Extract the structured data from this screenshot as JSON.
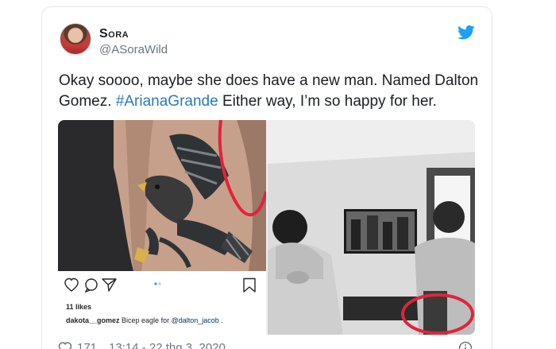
{
  "author": {
    "name": "Sora",
    "handle": "@ASoraWild"
  },
  "tweet": {
    "text_before": "Okay soooo, maybe she does have a new man. Named Dalton Gomez. ",
    "hashtag": "#ArianaGrande",
    "text_after": " Either way, I’m so happy for her."
  },
  "instagram": {
    "likes": "11 likes",
    "caption_user": "dakota__gomez",
    "caption_text": " Bicep eagle for ",
    "caption_mention": "@dalton_jacob",
    "caption_end": " ."
  },
  "footer": {
    "like_count": "171",
    "timestamp": "13:14 - 22 thg 3, 2020"
  },
  "colors": {
    "twitter_blue": "#1da1f2",
    "hashtag": "#2b7bb9",
    "circle_red": "#e0243a"
  },
  "icons": [
    "twitter-bird-icon",
    "heart-icon",
    "info-icon",
    "ig-heart-icon",
    "ig-comment-icon",
    "ig-share-icon",
    "ig-bookmark-icon"
  ]
}
